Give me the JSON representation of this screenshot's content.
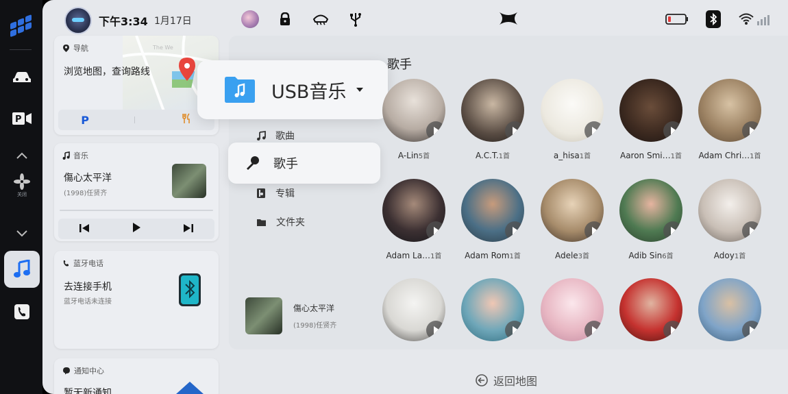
{
  "status_bar": {
    "time": "下午3:34",
    "date": "1月17日",
    "icons": [
      "avatar-icon",
      "profile-icon",
      "lock-icon",
      "defrost-icon",
      "usb-icon",
      "brand-logo-icon",
      "battery-icon",
      "bluetooth-icon",
      "wifi-icon"
    ]
  },
  "dock": {
    "items": [
      "apps-grid-icon",
      "car-icon",
      "parking-camera-icon",
      "chevron-up-icon",
      "fan-icon",
      "chevron-down-icon",
      "music-icon",
      "phone-icon"
    ],
    "fan_label": "关闭"
  },
  "cards": {
    "nav": {
      "header": "导航",
      "title": "浏览地图，查询路线",
      "map_label": "The We"
    },
    "music": {
      "header": "音乐",
      "title": "傷心太平洋",
      "subtitle": "(1998)任贤齐"
    },
    "phone": {
      "header": "蓝牙电话",
      "title": "去连接手机",
      "subtitle": "蓝牙电话未连接"
    },
    "notify": {
      "header": "通知中心",
      "title": "暂无新通知"
    }
  },
  "source": {
    "label": "USB音乐"
  },
  "menu": {
    "songs": "歌曲",
    "singers": "歌手",
    "albums": "专辑",
    "folders": "文件夹"
  },
  "now_playing": {
    "title": "傷心太平洋",
    "subtitle": "(1998)任贤齐"
  },
  "section_title": "歌手",
  "artists": [
    {
      "name": "A-Lin",
      "count": "5首"
    },
    {
      "name": "A.C.T.",
      "count": "1首"
    },
    {
      "name": "a_hisa",
      "count": "1首"
    },
    {
      "name": "Aaron Smi…",
      "count": "1首"
    },
    {
      "name": "Adam Chri…",
      "count": "1首"
    },
    {
      "name": "Adam La…",
      "count": "1首"
    },
    {
      "name": "Adam Rom",
      "count": "1首"
    },
    {
      "name": "Adele",
      "count": "3首"
    },
    {
      "name": "Adib Sin",
      "count": "6首"
    },
    {
      "name": "Adoy",
      "count": "1首"
    },
    {
      "name": "",
      "count": ""
    },
    {
      "name": "",
      "count": ""
    },
    {
      "name": "",
      "count": ""
    },
    {
      "name": "",
      "count": ""
    },
    {
      "name": "",
      "count": ""
    }
  ],
  "back_map": "返回地图",
  "colors": {
    "accent": "#1d6ef2",
    "folder": "#3aa0f0",
    "bluetooth": "#1fb6c8"
  }
}
